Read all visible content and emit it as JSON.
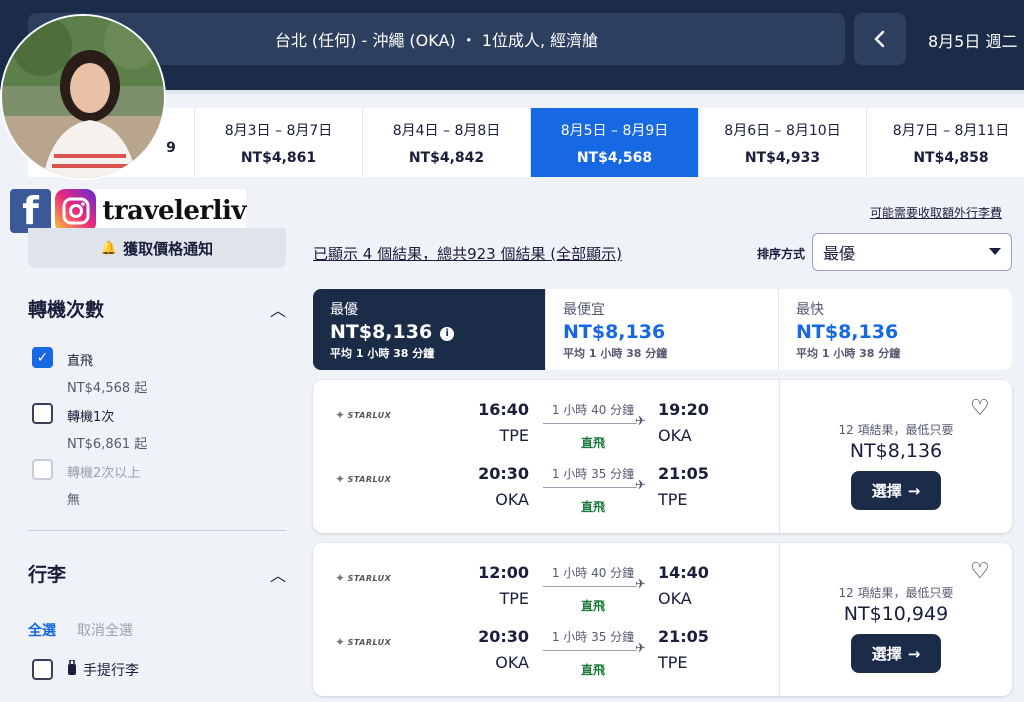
{
  "header": {
    "search_summary": "台北 (任何) - 沖繩 (OKA) ・ 1位成人, 經濟艙",
    "date": "8月5日 週二"
  },
  "date_strip": [
    {
      "range": "",
      "price": "9"
    },
    {
      "range": "8月3日 – 8月7日",
      "price": "NT$4,861"
    },
    {
      "range": "8月4日 – 8月8日",
      "price": "NT$4,842"
    },
    {
      "range": "8月5日 – 8月9日",
      "price": "NT$4,568"
    },
    {
      "range": "8月6日 – 8月10日",
      "price": "NT$4,933"
    },
    {
      "range": "8月7日 – 8月11日",
      "price": "NT$4,858"
    }
  ],
  "overlay": {
    "name": "travelerliv"
  },
  "sidebar": {
    "alert_button": "獲取價格通知",
    "stops_title": "轉機次數",
    "stops": [
      {
        "label": "直飛",
        "price": "NT$4,568 起",
        "checked": true
      },
      {
        "label": "轉機1次",
        "price": "NT$6,861 起",
        "checked": false
      },
      {
        "label": "轉機2次以上",
        "price": "無",
        "checked": false
      }
    ],
    "baggage_title": "行李",
    "select_all": "全選",
    "deselect_all": "取消全選",
    "baggage_item": "手提行李"
  },
  "results": {
    "fee_note": "可能需要收取額外行李費",
    "count_text": "已顯示 4 個結果，總共923 個結果 (全部顯示)",
    "sort_label": "排序方式",
    "sort_value": "最優"
  },
  "sort_tabs": [
    {
      "title": "最優",
      "price": "NT$8,136",
      "duration": "平均 1 小時 38 分鐘"
    },
    {
      "title": "最便宜",
      "price": "NT$8,136",
      "duration": "平均 1 小時 38 分鐘"
    },
    {
      "title": "最快",
      "price": "NT$8,136",
      "duration": "平均 1 小時 38 分鐘"
    }
  ],
  "cards": [
    {
      "airline": "STARLUX",
      "legs": [
        {
          "dep": "16:40",
          "dep_code": "TPE",
          "dur": "1 小時 40 分鐘",
          "stops": "直飛",
          "arr": "19:20",
          "arr_code": "OKA"
        },
        {
          "dep": "20:30",
          "dep_code": "OKA",
          "dur": "1 小時 35 分鐘",
          "stops": "直飛",
          "arr": "21:05",
          "arr_code": "TPE"
        }
      ],
      "note": "12 項結果，最低只要",
      "price": "NT$8,136",
      "select": "選擇"
    },
    {
      "airline": "STARLUX",
      "legs": [
        {
          "dep": "12:00",
          "dep_code": "TPE",
          "dur": "1 小時 40 分鐘",
          "stops": "直飛",
          "arr": "14:40",
          "arr_code": "OKA"
        },
        {
          "dep": "20:30",
          "dep_code": "OKA",
          "dur": "1 小時 35 分鐘",
          "stops": "直飛",
          "arr": "21:05",
          "arr_code": "TPE"
        }
      ],
      "note": "12 項結果，最低只要",
      "price": "NT$10,949",
      "select": "選擇"
    }
  ],
  "colors": {
    "accent": "#1668e3",
    "header": "#1b2c49",
    "nonstop": "#1c7a3c"
  }
}
